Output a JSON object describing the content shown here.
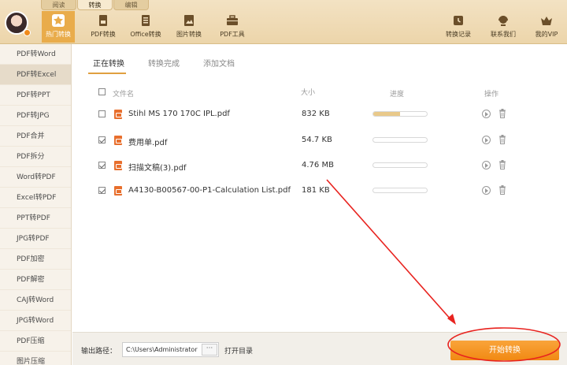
{
  "menu_tabs": [
    "阅读",
    "转换",
    "编辑"
  ],
  "toolbar": {
    "items": [
      {
        "label": "热门转换",
        "icon": "star-icon"
      },
      {
        "label": "PDF转换",
        "icon": "pdf-icon"
      },
      {
        "label": "Office转换",
        "icon": "document-icon"
      },
      {
        "label": "图片转换",
        "icon": "image-icon"
      },
      {
        "label": "PDF工具",
        "icon": "toolbox-icon"
      }
    ],
    "right_items": [
      {
        "label": "转换记录",
        "icon": "history-icon"
      },
      {
        "label": "联系我们",
        "icon": "headset-icon"
      },
      {
        "label": "我的VIP",
        "icon": "crown-icon"
      }
    ]
  },
  "sidebar": {
    "items": [
      "PDF转Word",
      "PDF转Excel",
      "PDF转PPT",
      "PDF转JPG",
      "PDF合并",
      "PDF拆分",
      "Word转PDF",
      "Excel转PDF",
      "PPT转PDF",
      "JPG转PDF",
      "PDF加密",
      "PDF解密",
      "CAJ转Word",
      "JPG转Word",
      "PDF压缩",
      "图片压缩"
    ],
    "selected": "PDF转Excel"
  },
  "content_tabs": [
    "正在转换",
    "转换完成",
    "添加文档"
  ],
  "table": {
    "headers": {
      "name": "文件名",
      "size": "大小",
      "progress": "进度",
      "action": "操作"
    },
    "rows": [
      {
        "name": "Stihl MS 170 170C IPL.pdf",
        "size": "832 KB",
        "checked": false,
        "progress": 0.5
      },
      {
        "name": "费用单.pdf",
        "size": "54.7 KB",
        "checked": true,
        "progress": 0
      },
      {
        "name": "扫描文稿(3).pdf",
        "size": "4.76 MB",
        "checked": true,
        "progress": 0
      },
      {
        "name": "A4130-B00567-00-P1-Calculation List.pdf",
        "size": "181 KB",
        "checked": true,
        "progress": 0
      }
    ]
  },
  "footer": {
    "path_label": "输出路径：",
    "path_value": "C:\\Users\\Administrator",
    "browse_label": "···",
    "open_dir": "打开目录",
    "start_button": "开始转换"
  },
  "colors": {
    "accent": "#f18913",
    "annotation": "#e8231f",
    "toolbar_bg": "#f3e2c3"
  }
}
